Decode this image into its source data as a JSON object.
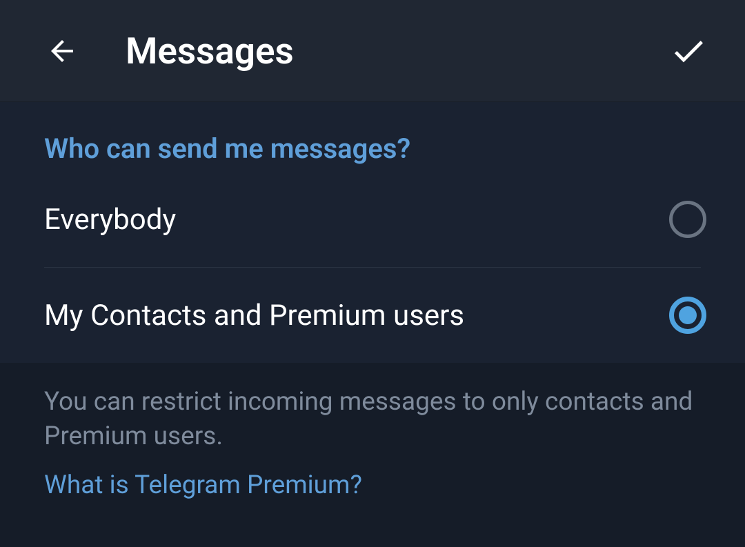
{
  "header": {
    "title": "Messages"
  },
  "section": {
    "title": "Who can send me messages?",
    "options": [
      {
        "label": "Everybody",
        "selected": false
      },
      {
        "label": "My Contacts and Premium users",
        "selected": true
      }
    ]
  },
  "footer": {
    "description": "You can restrict incoming messages to only contacts and Premium users.",
    "link": "What is Telegram Premium?"
  }
}
